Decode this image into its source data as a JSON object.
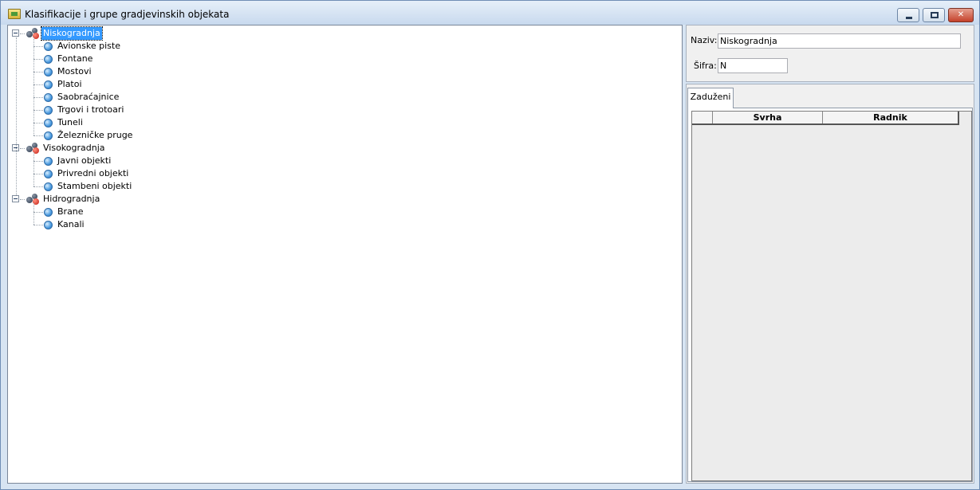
{
  "window": {
    "title": "Klasifikacije i grupe gradjevinskih objekata",
    "minimize_label": "",
    "maximize_label": "",
    "close_label": "✕"
  },
  "tree": {
    "groups": [
      {
        "label": "Niskogradnja",
        "selected": true,
        "children": [
          "Avionske piste",
          "Fontane",
          "Mostovi",
          "Platoi",
          "Saobraćajnice",
          "Trgovi i trotoari",
          "Tuneli",
          "Železničke pruge"
        ]
      },
      {
        "label": "Visokogradnja",
        "selected": false,
        "children": [
          "Javni objekti",
          "Privredni objekti",
          "Stambeni objekti"
        ]
      },
      {
        "label": "Hidrogradnja",
        "selected": false,
        "children": [
          "Brane",
          "Kanali"
        ]
      }
    ]
  },
  "form": {
    "naziv_label": "Naziv:",
    "naziv_value": "Niskogradnja",
    "sifra_label": "Šifra:",
    "sifra_value": "N"
  },
  "tabs": {
    "active": "Zaduženi"
  },
  "grid": {
    "columns": [
      "Svrha",
      "Radnik"
    ],
    "rows": []
  },
  "colors": {
    "selection": "#3399ff",
    "titlebar": "#c8d9ee"
  }
}
